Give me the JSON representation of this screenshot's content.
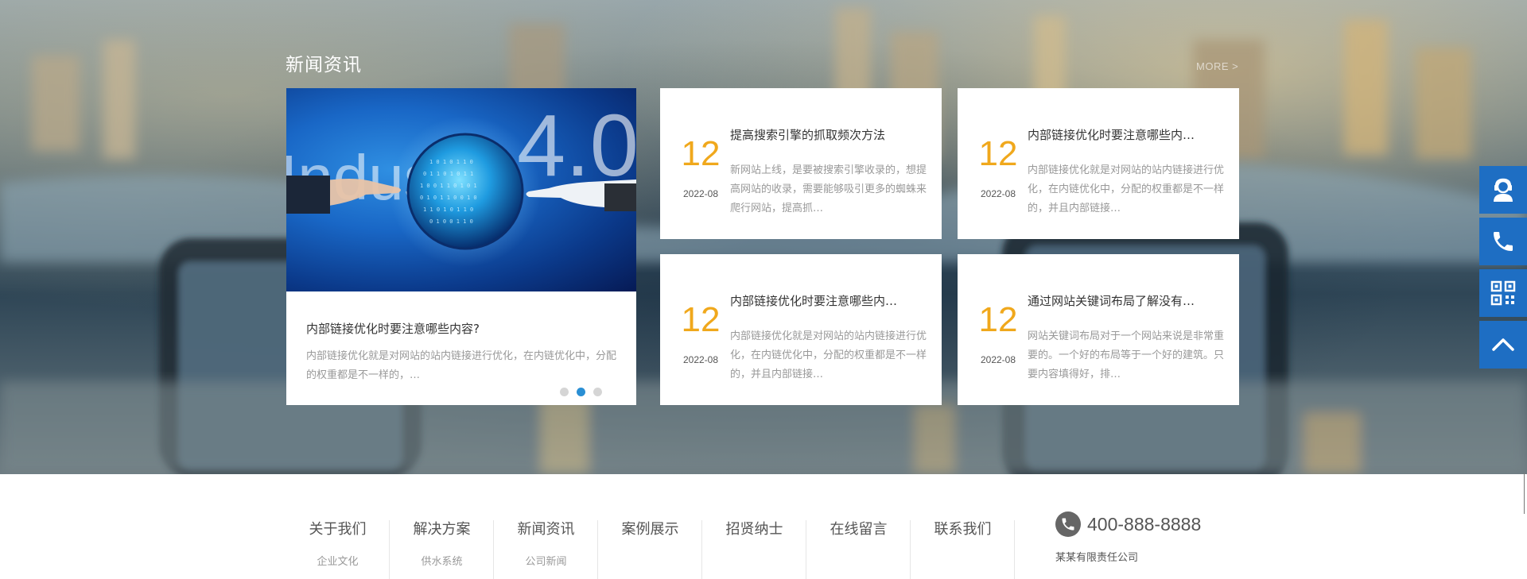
{
  "news": {
    "title": "新闻资讯",
    "more": "MORE >",
    "featured": {
      "title": "内部链接优化时要注意哪些内容?",
      "desc": "内部链接优化就是对网站的站内链接进行优化，在内链优化中，分配的权重都是不一样的，…",
      "image_label": "Industry 4.0",
      "slides": 3,
      "active_slide": 2
    },
    "items": [
      {
        "day": "12",
        "month": "2022-08",
        "title": "提高搜索引擎的抓取频次方法",
        "desc": "新网站上线，是要被搜索引擎收录的，想提高网站的收录，需要能够吸引更多的蜘蛛来爬行网站，提高抓…"
      },
      {
        "day": "12",
        "month": "2022-08",
        "title": "内部链接优化时要注意哪些内…",
        "desc": "内部链接优化就是对网站的站内链接进行优化，在内链优化中，分配的权重都是不一样的，并且内部链接…"
      },
      {
        "day": "12",
        "month": "2022-08",
        "title": "内部链接优化时要注意哪些内…",
        "desc": "内部链接优化就是对网站的站内链接进行优化，在内链优化中，分配的权重都是不一样的，并且内部链接…"
      },
      {
        "day": "12",
        "month": "2022-08",
        "title": "通过网站关键词布局了解没有…",
        "desc": "网站关键词布局对于一个网站来说是非常重要的。一个好的布局等于一个好的建筑。只要内容填得好，排…"
      }
    ]
  },
  "footer": {
    "nav": [
      {
        "label": "关于我们",
        "sub": "企业文化"
      },
      {
        "label": "解决方案",
        "sub": "供水系统"
      },
      {
        "label": "新闻资讯",
        "sub": "公司新闻"
      },
      {
        "label": "案例展示",
        "sub": ""
      },
      {
        "label": "招贤纳士",
        "sub": ""
      },
      {
        "label": "在线留言",
        "sub": ""
      },
      {
        "label": "联系我们",
        "sub": ""
      }
    ],
    "phone": "400-888-8888",
    "company": "某某有限责任公司"
  },
  "sidebar": {
    "icons": [
      "customer-service-icon",
      "phone-icon",
      "qr-code-icon",
      "back-to-top-icon"
    ],
    "accent": "#1e6ec3"
  },
  "colors": {
    "date_accent": "#f0a81c",
    "dot_active": "#2a8fd4"
  }
}
